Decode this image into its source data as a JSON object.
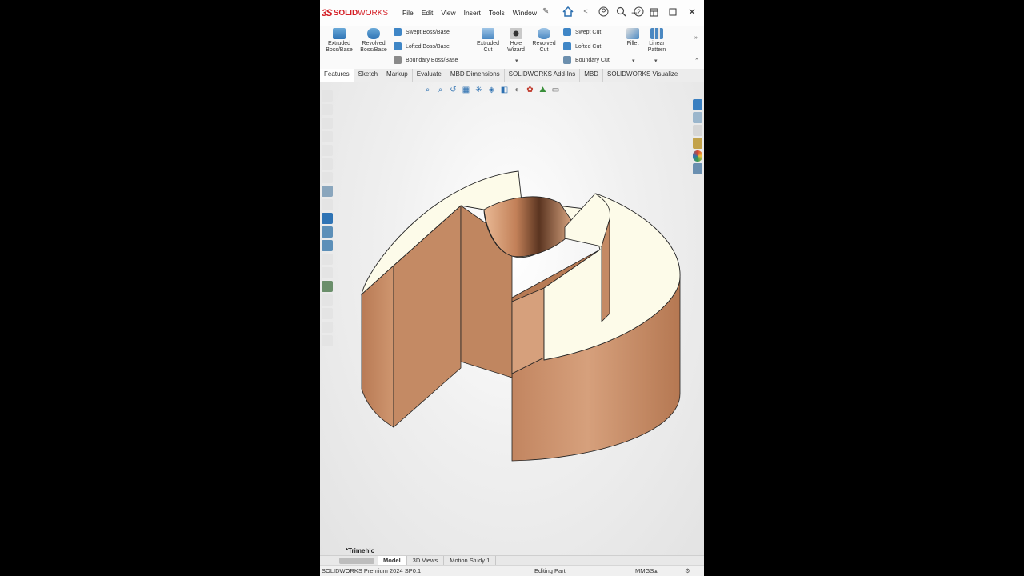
{
  "app": {
    "brand_prefix": "3S",
    "brand_solid": "SOLID",
    "brand_works": "WORKS",
    "accent_color": "#d41f26"
  },
  "menu": {
    "items": [
      "File",
      "Edit",
      "View",
      "Insert",
      "Tools",
      "Window"
    ]
  },
  "quick_icons": [
    "home-icon",
    "help-circle-icon",
    "search-icon",
    "question-icon"
  ],
  "window_controls": [
    "restore-icon",
    "minimize-icon",
    "maximize-icon",
    "close-icon"
  ],
  "ribbon": {
    "extruded_boss": "Extruded\nBoss/Base",
    "revolved_boss": "Revolved\nBoss/Base",
    "swept_boss": "Swept Boss/Base",
    "lofted_boss": "Lofted Boss/Base",
    "boundary_boss": "Boundary Boss/Base",
    "extruded_cut": "Extruded\nCut",
    "hole_wizard": "Hole\nWizard",
    "revolved_cut": "Revolved\nCut",
    "swept_cut": "Swept Cut",
    "lofted_cut": "Lofted Cut",
    "boundary_cut": "Boundary Cut",
    "fillet": "Fillet",
    "linear_pattern": "Linear\nPattern"
  },
  "tabs": [
    "Features",
    "Sketch",
    "Markup",
    "Evaluate",
    "MBD Dimensions",
    "SOLIDWORKS Add-Ins",
    "MBD",
    "SOLIDWORKS Visualize"
  ],
  "active_tab": "Features",
  "viewport": {
    "part_name": "*Trimehic",
    "model_colors": {
      "copper": "#c98f6a",
      "copper_dark": "#a8704e",
      "face": "#fdfbe9"
    }
  },
  "bottom_tabs": [
    "Model",
    "3D Views",
    "Motion Study 1"
  ],
  "active_bottom_tab": "Model",
  "status": {
    "version": "SOLIDWORKS Premium 2024 SP0.1",
    "mode": "Editing Part",
    "units": "MMGS"
  }
}
